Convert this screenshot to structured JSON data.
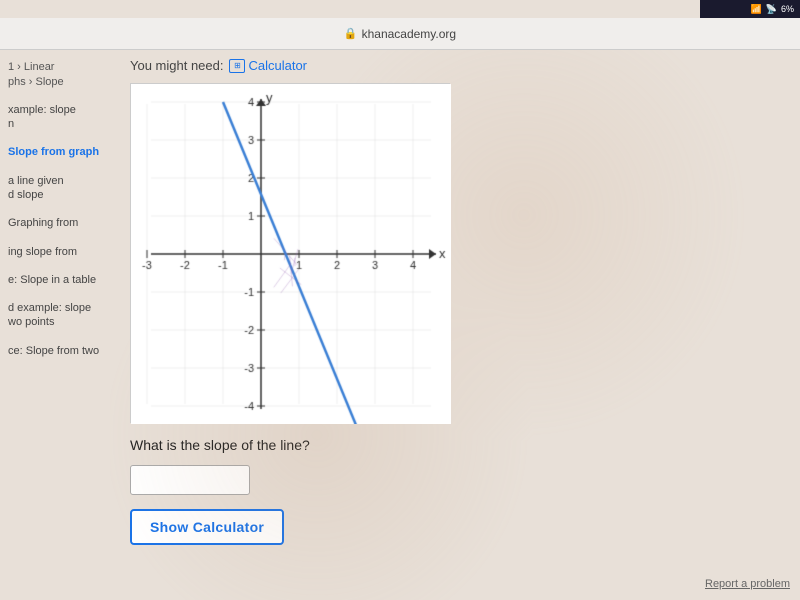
{
  "statusBar": {
    "battery": "6%",
    "signal": "●●●"
  },
  "browser": {
    "url": "khanacademy.org",
    "lockIcon": "🔒"
  },
  "mightNeed": {
    "label": "You might need:",
    "calculatorLink": "Calculator"
  },
  "sidebar": {
    "breadcrumb1": "1 › Linear",
    "breadcrumb2": "phs › Slope",
    "items": [
      {
        "label": "xample: slope\nn",
        "active": false
      },
      {
        "label": "Slope from graph",
        "active": true
      },
      {
        "label": "a line given\nd slope",
        "active": false
      },
      {
        "label": "Graphing from",
        "active": false
      },
      {
        "label": "ing slope from",
        "active": false
      },
      {
        "label": "e: Slope in a table",
        "active": false
      },
      {
        "label": "d example: slope\nwo points",
        "active": false
      },
      {
        "label": "ce: Slope from two",
        "active": false
      }
    ]
  },
  "graph": {
    "title": "coordinate graph",
    "xAxisLabel": "x",
    "yAxisLabel": "y"
  },
  "question": {
    "text": "What is the slope of the line?"
  },
  "buttons": {
    "showCalculator": "Show Calculator",
    "reportProblem": "Report a problem"
  },
  "input": {
    "placeholder": ""
  }
}
